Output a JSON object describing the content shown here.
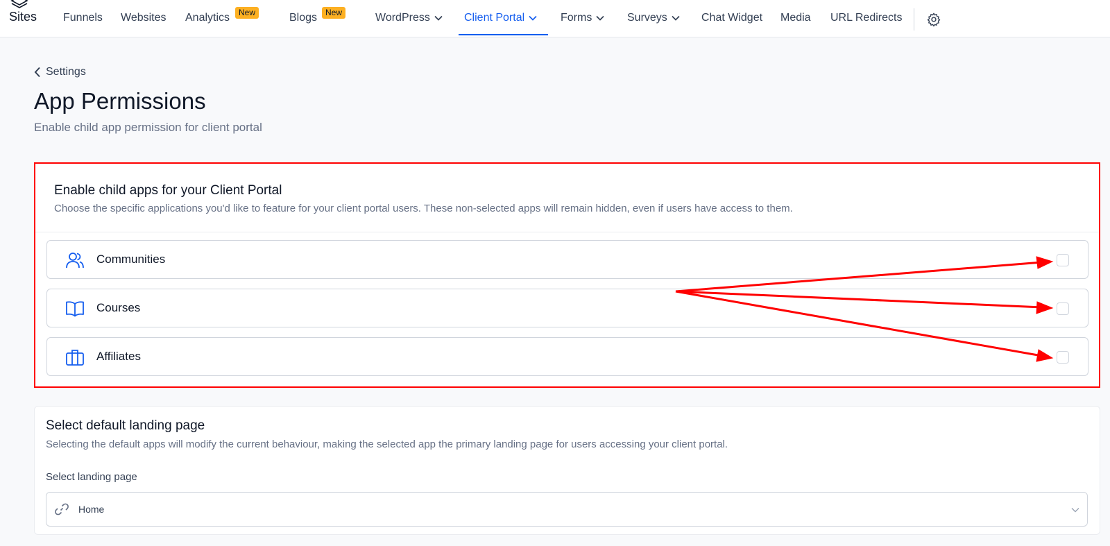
{
  "brand": {
    "name": "Sites",
    "logo_icon": "layers-icon"
  },
  "nav": {
    "funnels": "Funnels",
    "websites": "Websites",
    "analytics": "Analytics",
    "analytics_badge": "New",
    "blogs": "Blogs",
    "blogs_badge": "New",
    "wordpress": "WordPress",
    "client_portal": "Client Portal",
    "forms": "Forms",
    "surveys": "Surveys",
    "chat_widget": "Chat Widget",
    "media": "Media",
    "url_redirects": "URL Redirects",
    "settings_icon": "gear-icon",
    "active": "Client Portal"
  },
  "header": {
    "back_label": "Settings",
    "title": "App Permissions",
    "subtitle": "Enable child app permission for client portal"
  },
  "child_apps": {
    "title": "Enable child apps for your Client Portal",
    "description": "Choose the specific applications you'd like to feature for your client portal users. These non-selected apps will remain hidden, even if users have access to them.",
    "apps": [
      {
        "label": "Communities",
        "icon": "users-icon",
        "checked": false
      },
      {
        "label": "Courses",
        "icon": "book-open-icon",
        "checked": false
      },
      {
        "label": "Affiliates",
        "icon": "briefcase-icon",
        "checked": false
      }
    ]
  },
  "landing": {
    "title": "Select default landing page",
    "description": "Selecting the default apps will modify the current behaviour, making the selected app the primary landing page for users accessing your client portal.",
    "field_label": "Select landing page",
    "selected_value": "Home",
    "field_icon": "link-icon"
  },
  "colors": {
    "accent": "#155eef",
    "annotation": "#ff0000",
    "badge": "#fdb022"
  }
}
